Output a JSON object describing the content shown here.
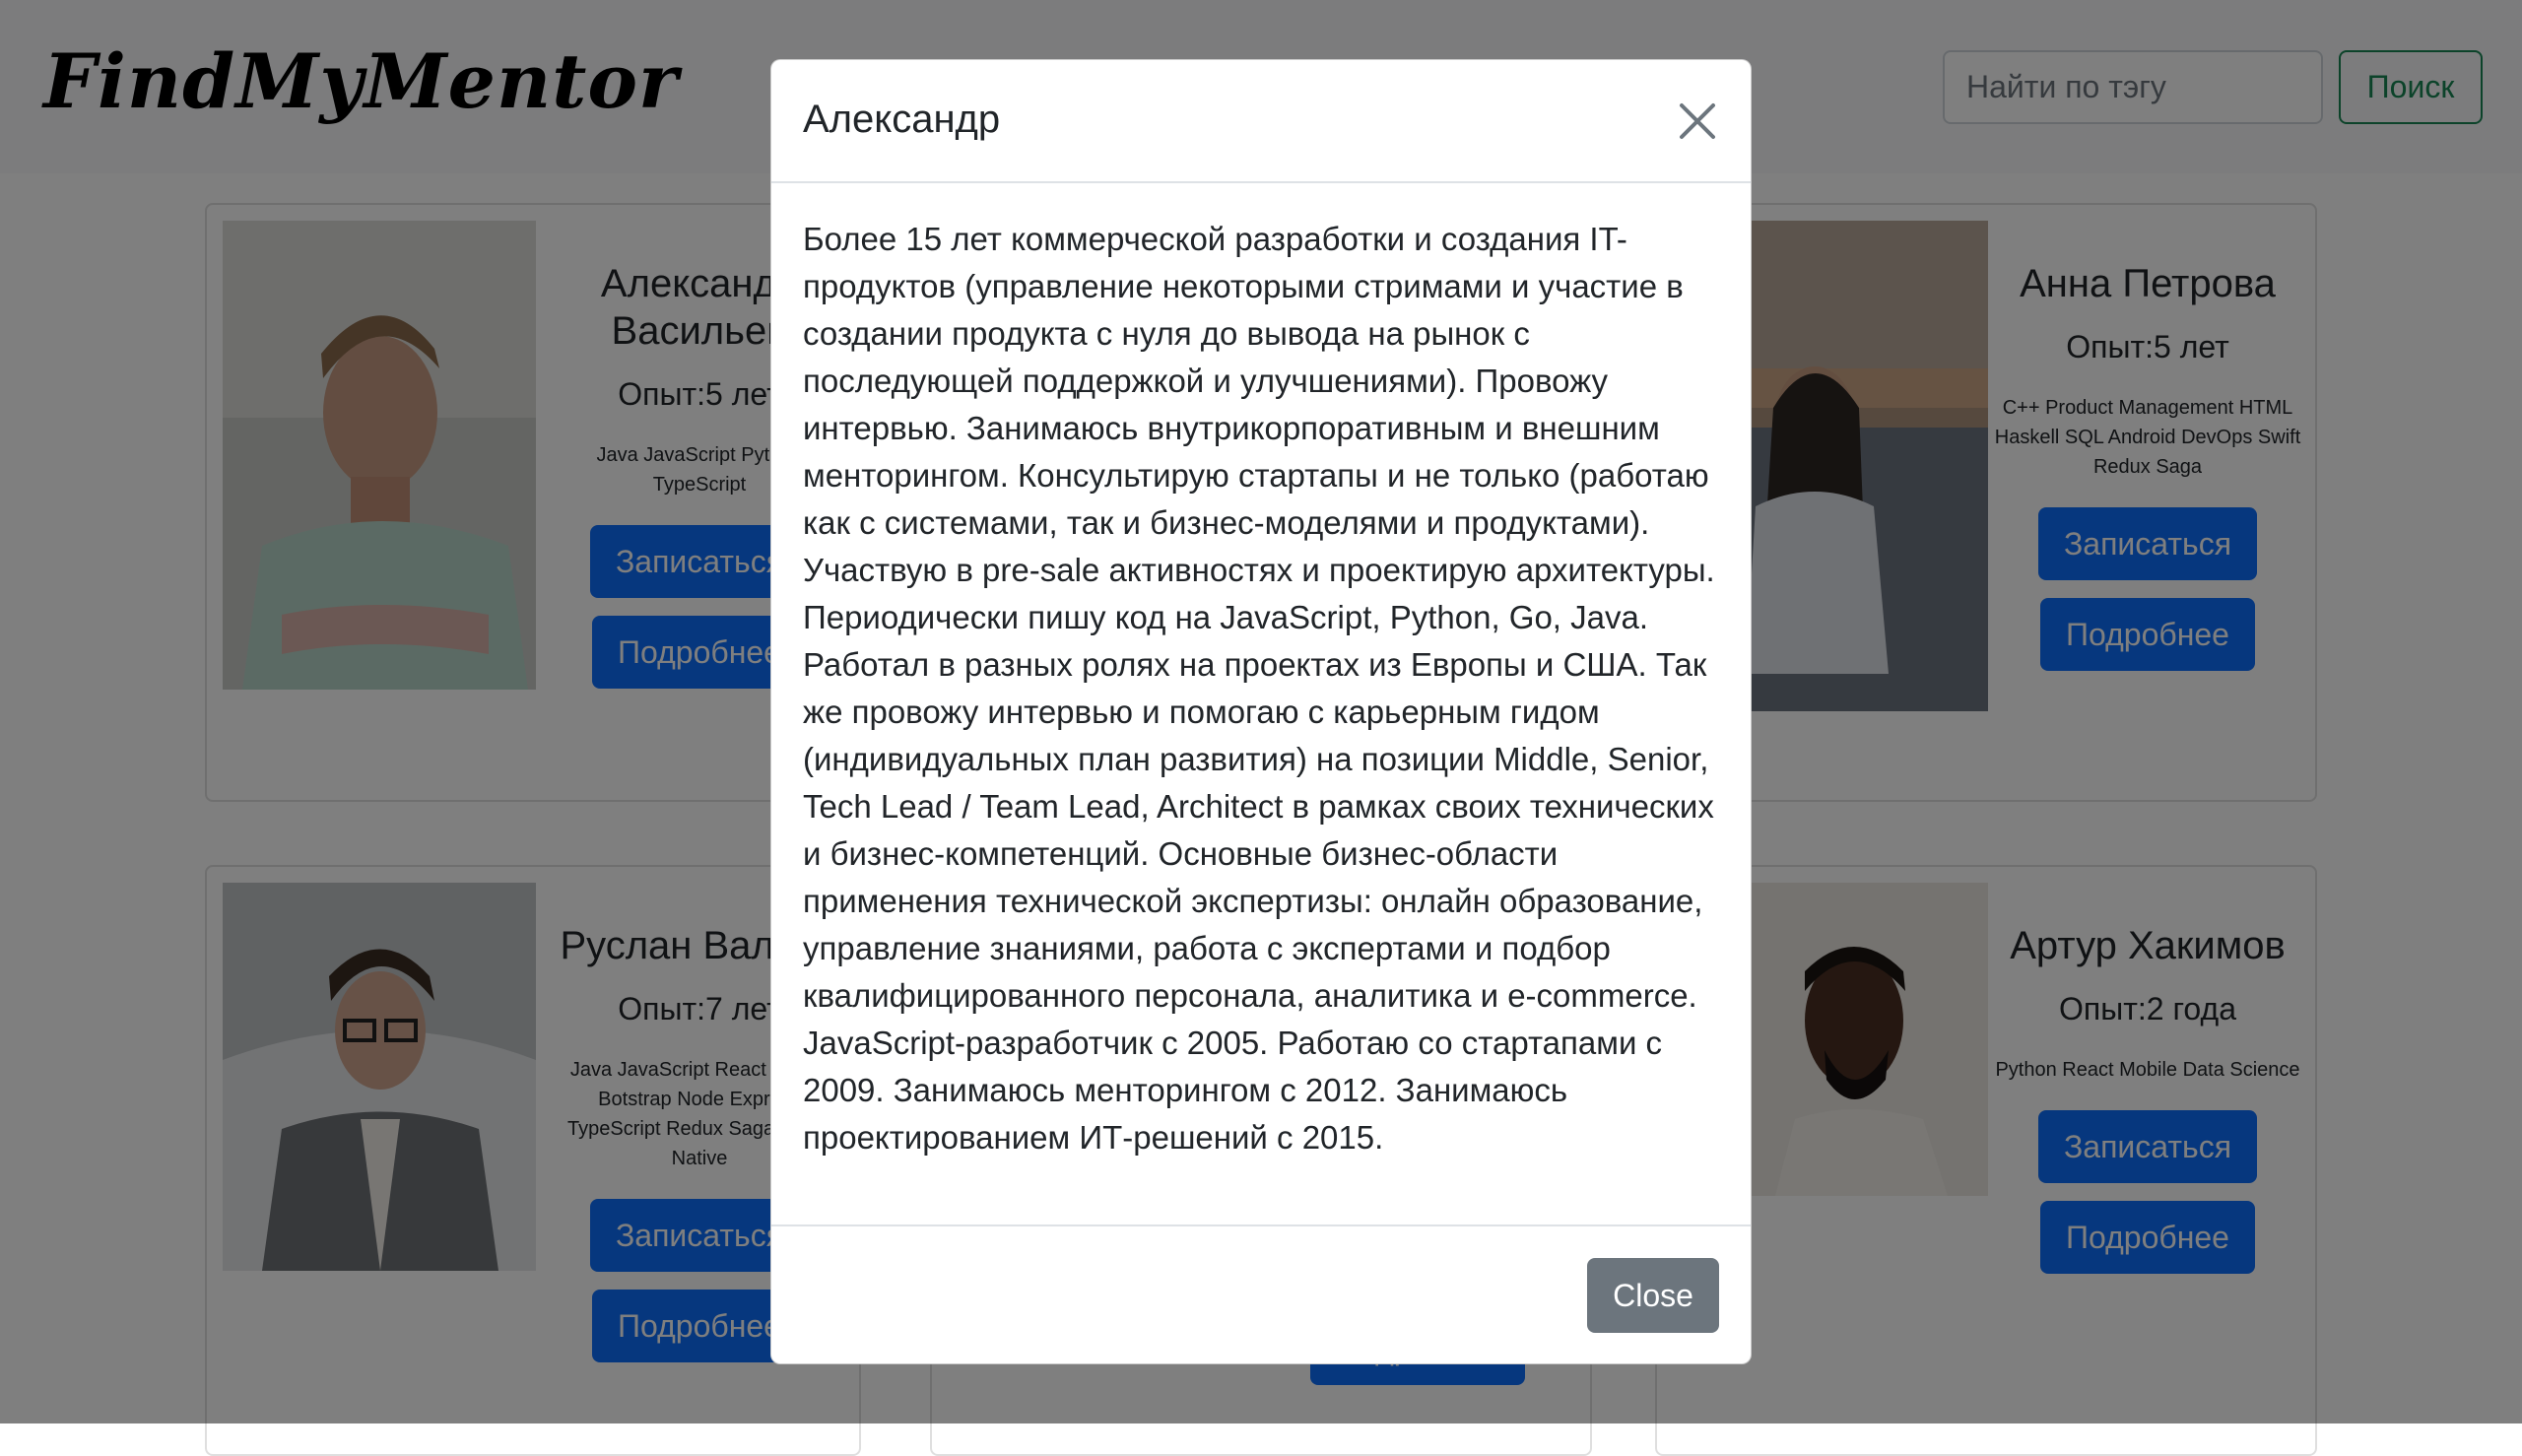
{
  "navbar": {
    "brand": "FindMyMentor",
    "search_placeholder": "Найти по тэгу",
    "search_button": "Поиск"
  },
  "mentors": [
    {
      "name": "Александр Васильев",
      "experience": "Опыт:5 лет",
      "tags": "Java JavaScript Python TypeScript",
      "signup_label": "Записаться",
      "details_label": "Подробнее"
    },
    {
      "name": "Анна Петрова",
      "experience": "Опыт:5 лет",
      "tags": "C++ Product Management HTML Haskell SQL Android DevOps Swift Redux Saga",
      "signup_label": "Записаться",
      "details_label": "Подробнее"
    },
    {
      "name": "Руслан Валеев",
      "experience": "Опыт:7 лет",
      "tags": "Java JavaScript React Redux Botstrap Node Express TypeScript Redux Saga React Native",
      "signup_label": "Записаться",
      "details_label": "Подробнее"
    },
    {
      "name": "",
      "details_label": "Подробнее"
    },
    {
      "name": "Артур Хакимов",
      "experience": "Опыт:2 года",
      "tags": "Python React Mobile Data Science",
      "signup_label": "Записаться",
      "details_label": "Подробнее"
    }
  ],
  "modal": {
    "title": "Александр",
    "body": "Более 15 лет коммерческой разработки и создания IT-продуктов (управление некоторыми стримами и участие в создании продукта с нуля до вывода на рынок с последующей поддержкой и улучшениями). Провожу интервью. Занимаюсь внутрикорпоративным и внешним менторингом. Консультирую стартапы и не только (работаю как с системами, так и бизнес-моделями и продуктами). Участвую в pre-sale активностях и проектирую архитектуры. Периодически пишу код на JavaScript, Python, Go, Java. Работал в разных ролях на проектах из Европы и США. Так же провожу интервью и помогаю с карьерным гидом (индивидуальных план развития) на позиции Middle, Senior, Tech Lead / Team Lead, Architect в рамках своих технических и бизнес-компетенций. Основные бизнес-области применения технической экспертизы: онлайн образование, управление знаниями, работа с экспертами и подбор квалифицированного персонала, аналитика и e-commerce. JavaScript-разработчик с 2005. Работаю со стартапами с 2009. Занимаюсь менторингом с 2012. Занимаюсь проектированием ИТ-решений с 2015.",
    "close_button": "Close"
  }
}
